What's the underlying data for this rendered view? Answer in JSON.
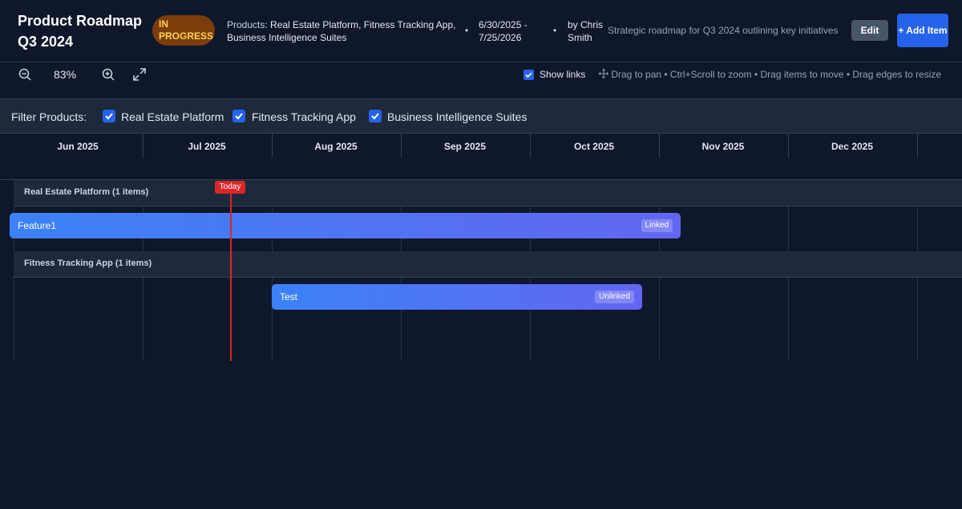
{
  "header": {
    "title": "Product Roadmap Q3 2024",
    "status": "IN PROGRESS",
    "products_label": "Products:",
    "products_value": "Real Estate Platform, Fitness Tracking App, Business Intelligence Suites",
    "separator": "•",
    "dates": "6/30/2025 - 7/25/2026",
    "author": "by Chris Smith",
    "description": "Strategic roadmap for Q3 2024 outlining key initiatives",
    "edit_label": "Edit",
    "add_label": "+ Add Item"
  },
  "toolbar": {
    "zoom_value": "83%",
    "zoom_out_icon": "zoom-out-icon",
    "zoom_in_icon": "zoom-in-icon",
    "fullscreen_icon": "expand-icon",
    "show_links_label": "Show links",
    "show_links_checked": true,
    "hint": "Drag to pan • Ctrl+Scroll to zoom • Drag items to move • Drag edges to resize"
  },
  "filter": {
    "label": "Filter Products:",
    "products": [
      {
        "label": "Real Estate Platform",
        "checked": true
      },
      {
        "label": "Fitness Tracking App",
        "checked": true
      },
      {
        "label": "Business Intelligence Suites",
        "checked": true
      }
    ]
  },
  "timeline": {
    "months": [
      "Jun 2025",
      "Jul 2025",
      "Aug 2025",
      "Sep 2025",
      "Oct 2025",
      "Nov 2025",
      "Dec 2025"
    ],
    "today_label": "Today",
    "groups": [
      {
        "title": "Real Estate Platform (1 items)",
        "items": [
          {
            "label": "Feature1",
            "badge": "Linked"
          }
        ]
      },
      {
        "title": "Fitness Tracking App (1 items)",
        "items": [
          {
            "label": "Test",
            "badge": "Unlinked"
          }
        ]
      }
    ]
  },
  "colors": {
    "background": "#0f172a",
    "accent": "#2563eb",
    "today": "#dc2626",
    "status_bg": "#7c3d0d",
    "status_text": "#fcd34d"
  }
}
